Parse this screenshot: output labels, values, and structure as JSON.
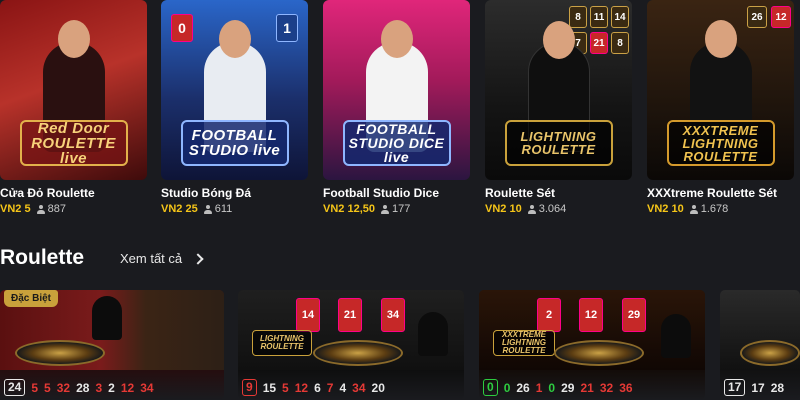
{
  "top_games": [
    {
      "title": "Cửa Đỏ Roulette",
      "price": "VN2 5",
      "players": "887",
      "logo": "Red Door ROULETTE live"
    },
    {
      "title": "Studio Bóng Đá",
      "price": "VN2 25",
      "players": "611",
      "logo": "FOOTBALL STUDIO live"
    },
    {
      "title": "Football Studio Dice",
      "price": "VN2 12,50",
      "players": "177",
      "logo": "FOOTBALL STUDIO DICE live"
    },
    {
      "title": "Roulette Sét",
      "price": "VN2 10",
      "players": "3.064",
      "logo": "LIGHTNING ROULETTE"
    },
    {
      "title": "XXXtreme Roulette Sét",
      "price": "VN2 10",
      "players": "1.678",
      "logo": "XXXTREME LIGHTNING ROULETTE"
    }
  ],
  "card_tiles": {
    "c2": [
      "0",
      "1"
    ],
    "c4": [
      "8",
      "11",
      "14",
      "7",
      "21",
      "8"
    ],
    "c5": [
      "26",
      "12"
    ]
  },
  "section": {
    "title": "Roulette",
    "see_all": "Xem tất cả"
  },
  "roulette_tables": [
    {
      "badge": "Đặc Biệt",
      "results": [
        {
          "v": "24",
          "c": "white",
          "boxed": true
        },
        {
          "v": "5",
          "c": "red"
        },
        {
          "v": "5",
          "c": "red"
        },
        {
          "v": "32",
          "c": "red"
        },
        {
          "v": "28",
          "c": "white"
        },
        {
          "v": "3",
          "c": "red"
        },
        {
          "v": "2",
          "c": "white"
        },
        {
          "v": "12",
          "c": "red"
        },
        {
          "v": "34",
          "c": "red"
        }
      ]
    },
    {
      "tiles": [
        "14",
        "21",
        "34"
      ],
      "logo": "LIGHTNING ROULETTE",
      "results": [
        {
          "v": "9",
          "c": "red",
          "boxed": true
        },
        {
          "v": "15",
          "c": "white"
        },
        {
          "v": "5",
          "c": "red"
        },
        {
          "v": "12",
          "c": "red"
        },
        {
          "v": "6",
          "c": "white"
        },
        {
          "v": "7",
          "c": "red"
        },
        {
          "v": "4",
          "c": "white"
        },
        {
          "v": "34",
          "c": "red"
        },
        {
          "v": "20",
          "c": "white"
        }
      ]
    },
    {
      "tiles": [
        "2",
        "12",
        "29"
      ],
      "logo": "XXXTREME LIGHTNING ROULETTE",
      "results": [
        {
          "v": "0",
          "c": "green",
          "boxed": true
        },
        {
          "v": "0",
          "c": "green"
        },
        {
          "v": "26",
          "c": "white"
        },
        {
          "v": "1",
          "c": "red"
        },
        {
          "v": "0",
          "c": "green"
        },
        {
          "v": "29",
          "c": "white"
        },
        {
          "v": "21",
          "c": "red"
        },
        {
          "v": "32",
          "c": "red"
        },
        {
          "v": "36",
          "c": "red"
        }
      ]
    },
    {
      "results": [
        {
          "v": "17",
          "c": "white",
          "boxed": true
        },
        {
          "v": "17",
          "c": "white"
        },
        {
          "v": "28",
          "c": "white"
        }
      ]
    }
  ],
  "colors": {
    "background": "#1a1b1f",
    "price": "#f5c518",
    "red_number": "#e53935",
    "green_number": "#2ecc40",
    "badge": "#c9a13b"
  }
}
